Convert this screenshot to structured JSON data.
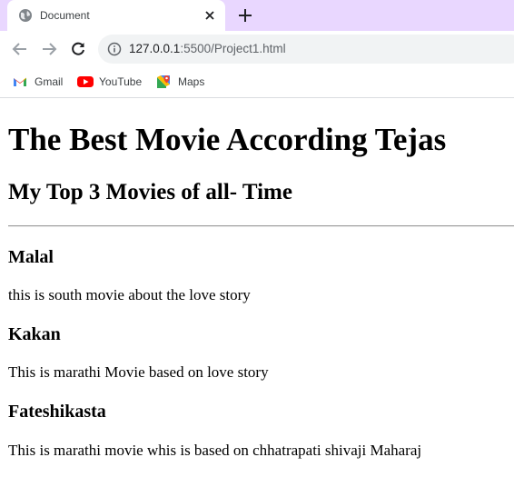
{
  "browser": {
    "tab": {
      "title": "Document"
    },
    "address_bar": {
      "host": "127.0.0.1",
      "rest": ":5500/Project1.html"
    },
    "bookmarks": [
      {
        "label": "Gmail"
      },
      {
        "label": "YouTube"
      },
      {
        "label": "Maps"
      }
    ]
  },
  "page": {
    "heading": "The Best Movie According Tejas",
    "subheading": "My Top 3 Movies of all- Time",
    "movies": [
      {
        "title": "Malal",
        "description": "this is south movie about the love story"
      },
      {
        "title": "Kakan",
        "description": "This is marathi Movie based on love story"
      },
      {
        "title": "Fateshikasta",
        "description": "This is marathi movie whis is based on chhatrapati shivaji Maharaj"
      }
    ]
  }
}
